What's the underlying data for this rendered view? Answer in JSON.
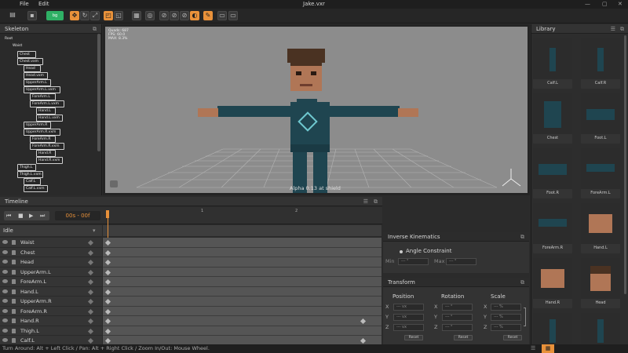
{
  "window": {
    "menu": [
      "File",
      "Edit"
    ],
    "title": "Jake.vxr",
    "min": "—",
    "max": "▢",
    "close": "✕"
  },
  "toolbar": {
    "bg_badge": "bg"
  },
  "skeleton": {
    "title": "Skeleton",
    "nodes": [
      "Root",
      "Waist",
      "Chest",
      "Chest.vxm",
      "Head",
      "Head.vxm",
      "UpperArm.L",
      "UpperArm.L.vxm",
      "ForeArm.L",
      "ForeArm.L.vxm",
      "Hand.L",
      "Hand.L.vxm",
      "UpperArm.R",
      "UpperArm.R.vxm",
      "ForeArm.R",
      "ForeArm.R.vxm",
      "Hand.R",
      "Hand.R.vxm",
      "Thigh.L",
      "Thigh.L.vxm",
      "Calf.L",
      "Calf.L.vxm"
    ]
  },
  "viewport": {
    "stats": [
      "Quads: 687",
      "FPS: 60.0",
      "MAX: 8.3%"
    ],
    "watermark": "Alpha 0.13 at shield"
  },
  "timeline": {
    "title": "Timeline",
    "time": "00s - 00f",
    "ruler": [
      "1",
      "2"
    ],
    "clip": "Idle",
    "tracks": [
      "Waist",
      "Chest",
      "Head",
      "UpperArm.L",
      "ForeArm.L",
      "Hand.L",
      "UpperArm.R",
      "ForeArm.R",
      "Hand.R",
      "Thigh.L",
      "Calf.L"
    ],
    "end_keys": [
      false,
      false,
      false,
      false,
      false,
      false,
      false,
      false,
      true,
      false,
      true
    ]
  },
  "ik": {
    "title": "Inverse Kinematics",
    "angle_constraint": "Angle Constraint",
    "min_label": "Min",
    "max_label": "Max",
    "min_placeholder": "--- °",
    "max_placeholder": "--- °"
  },
  "transform": {
    "title": "Transform",
    "position": "Position",
    "rotation": "Rotation",
    "scale": "Scale",
    "axes": [
      "X",
      "Y",
      "Z"
    ],
    "pos_ph": "--- vx",
    "rot_ph": "--- °",
    "scale_ph": "--- %",
    "reset": "Reset"
  },
  "library": {
    "title": "Library",
    "items": [
      "Calf.L",
      "Calf.R",
      "Chest",
      "Foot.L",
      "Foot.R",
      "ForeArm.L",
      "ForeArm.R",
      "Hand.L",
      "Hand.R",
      "Head",
      "",
      ""
    ]
  },
  "status": "Turn Around: Alt + Left Click / Pan: Alt + Right Click / Zoom In/Out: Mouse Wheel.",
  "colors": {
    "accent": "#e8913a",
    "viewport_bg": "#8c8c8c",
    "green": "#2fb065"
  }
}
